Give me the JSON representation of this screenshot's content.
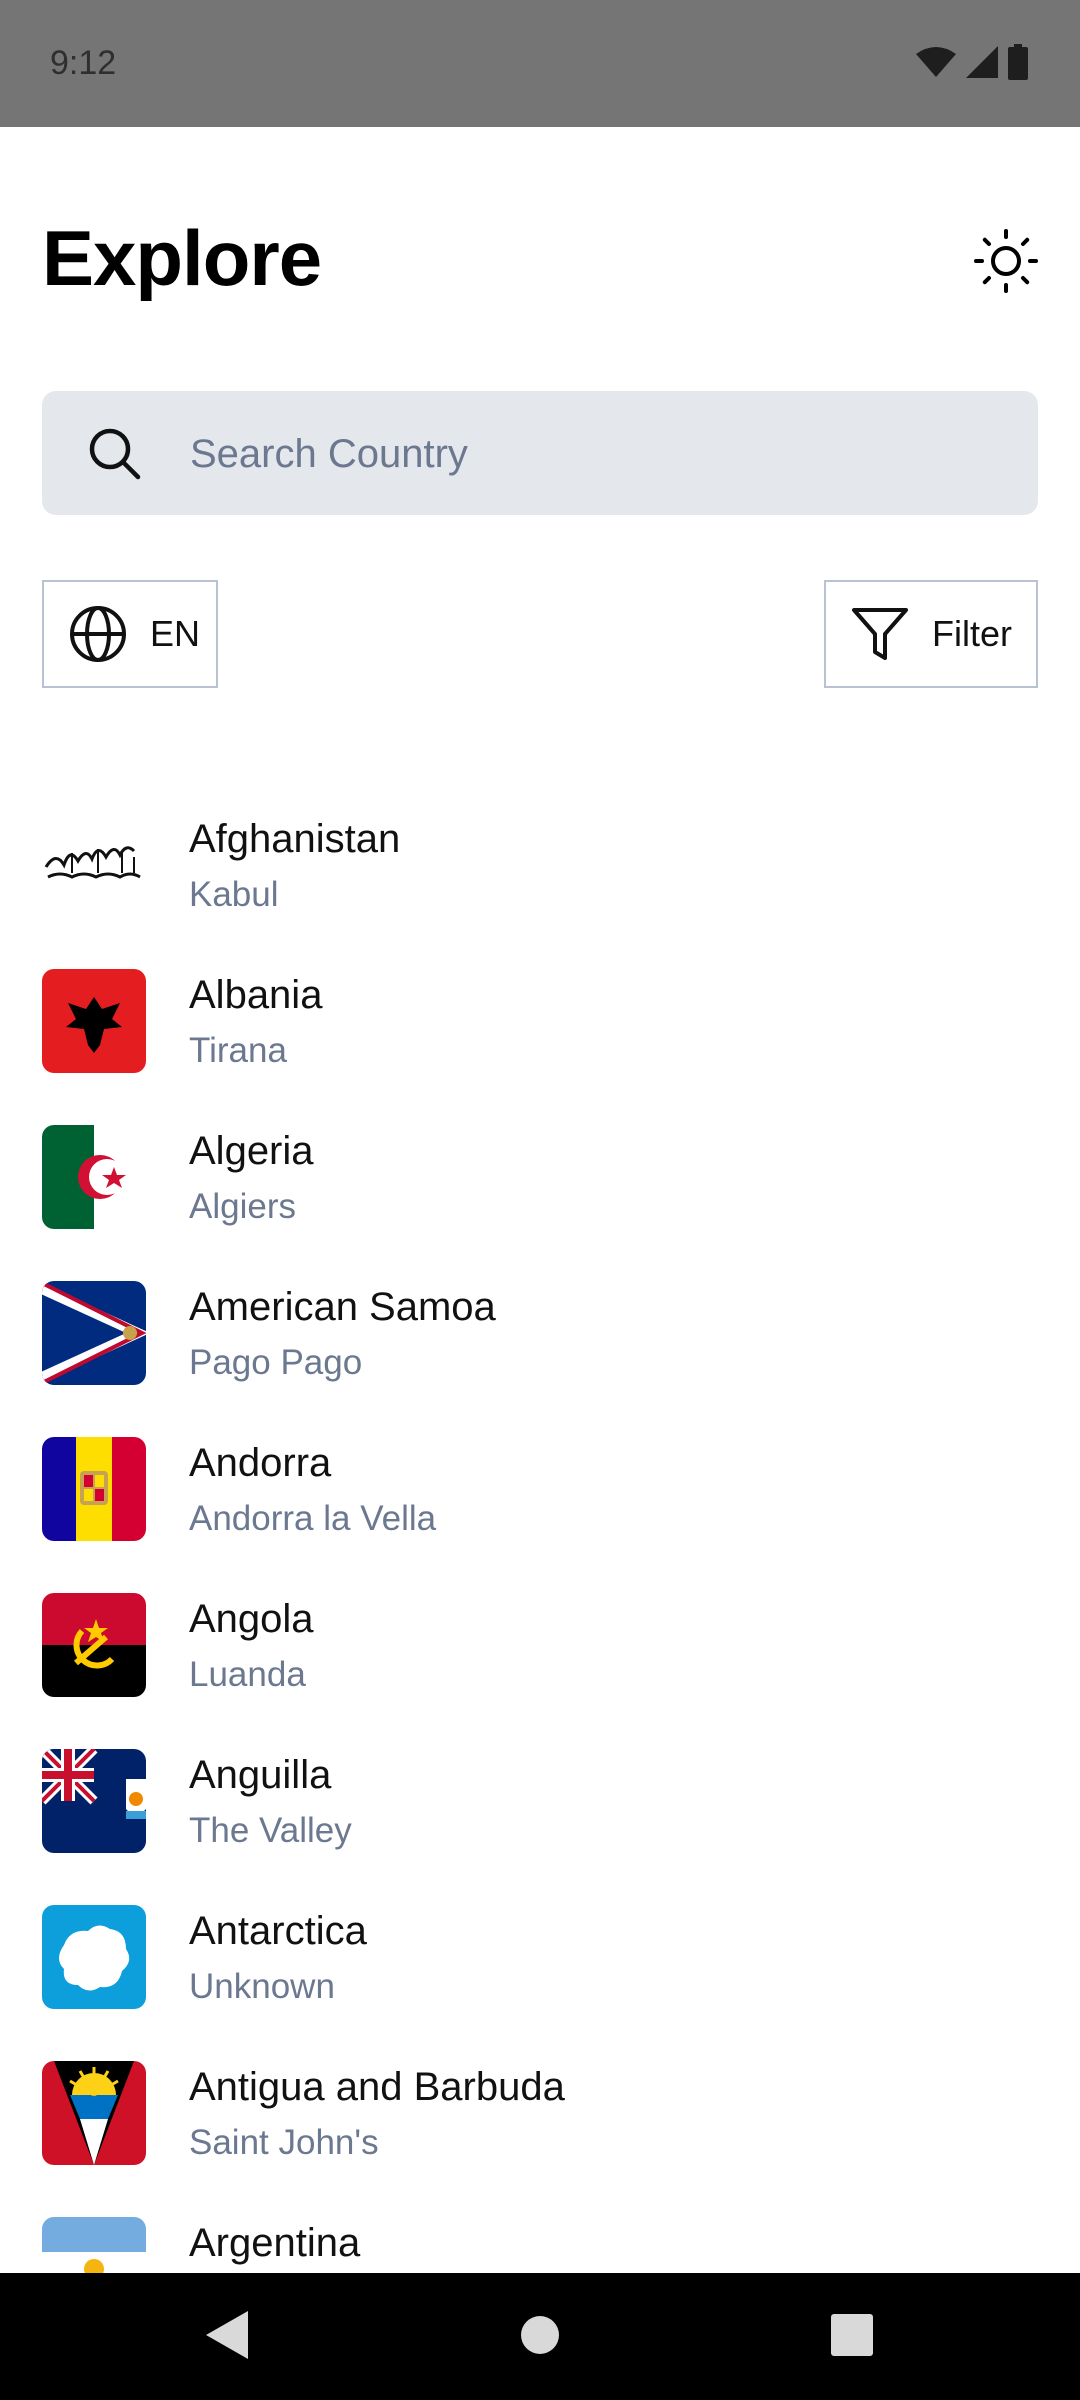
{
  "status_bar": {
    "time": "9:12"
  },
  "header": {
    "title": "Explore",
    "theme_icon": "sun-icon"
  },
  "search": {
    "placeholder": "Search Country",
    "value": ""
  },
  "controls": {
    "language_label": "EN",
    "language_icon": "globe-icon",
    "filter_label": "Filter",
    "filter_icon": "filter-icon"
  },
  "countries": [
    {
      "name": "Afghanistan",
      "capital": "Kabul"
    },
    {
      "name": "Albania",
      "capital": "Tirana"
    },
    {
      "name": "Algeria",
      "capital": "Algiers"
    },
    {
      "name": "American Samoa",
      "capital": "Pago Pago"
    },
    {
      "name": "Andorra",
      "capital": "Andorra la Vella"
    },
    {
      "name": "Angola",
      "capital": "Luanda"
    },
    {
      "name": "Anguilla",
      "capital": "The Valley"
    },
    {
      "name": "Antarctica",
      "capital": "Unknown"
    },
    {
      "name": "Antigua and Barbuda",
      "capital": "Saint John's"
    },
    {
      "name": "Argentina",
      "capital": ""
    }
  ],
  "colors": {
    "status_bar": "#757575",
    "search_bg": "#e4e7ec",
    "secondary_text": "#6b7890",
    "border": "#b8c2d2",
    "nav_bar": "#000000"
  }
}
